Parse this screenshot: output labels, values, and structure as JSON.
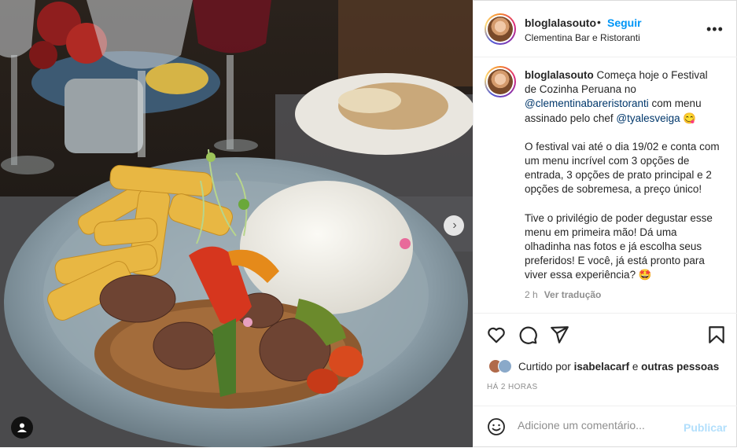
{
  "header": {
    "username": "bloglalasouto",
    "separator": "•",
    "follow_label": "Seguir",
    "location": "Clementina Bar e Ristoranti",
    "more_icon": "more-horizontal-icon"
  },
  "caption": {
    "username": "bloglalasouto",
    "intro_text": "Começa hoje o Festival de Cozinha Peruana no",
    "mention_venue": "@clementinabareristoranti",
    "middle_text": "com menu assinado pelo chef",
    "mention_chef": "@tyalesveiga",
    "emoji_1": "😋",
    "paragraph_2": "O festival vai até o dia 19/02 e conta com um menu incrível com 3 opções de entrada, 3 opções de prato principal e 2 opções de sobremesa, a preço único!",
    "paragraph_3": "Tive o privilégio de poder degustar esse menu em primeira mão! Dá uma olhadinha nas fotos e já escolha seus preferidos! E você, já está pronto para viver essa experiência?",
    "emoji_2": "🤩",
    "age": "2 h",
    "translate_label": "Ver tradução"
  },
  "actions": {
    "like_icon": "heart-icon",
    "comment_icon": "comment-icon",
    "share_icon": "send-icon",
    "save_icon": "bookmark-icon"
  },
  "likes": {
    "prefix": "Curtido por",
    "user": "isabelacarf",
    "connector": "e",
    "others": "outras pessoas"
  },
  "timestamp": "HÁ 2 HORAS",
  "comment": {
    "placeholder": "Adicione um comentário...",
    "post_label": "Publicar",
    "emoji_icon": "smiley-icon"
  },
  "photo": {
    "next_icon": "chevron-right-icon",
    "tag_icon": "user-tag-icon"
  },
  "colors": {
    "link": "#0095f6",
    "mention": "#00376b",
    "muted": "#8e8e8e",
    "post_disabled": "#b2dffc"
  }
}
